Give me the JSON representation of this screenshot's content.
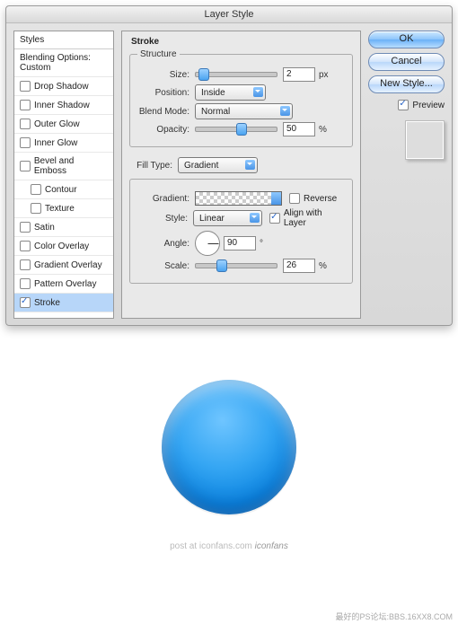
{
  "dialog_title": "Layer Style",
  "styles": {
    "header": "Styles",
    "blending": "Blending Options: Custom",
    "items": [
      {
        "label": "Drop Shadow",
        "on": false
      },
      {
        "label": "Inner Shadow",
        "on": false
      },
      {
        "label": "Outer Glow",
        "on": false
      },
      {
        "label": "Inner Glow",
        "on": false
      },
      {
        "label": "Bevel and Emboss",
        "on": false
      },
      {
        "label": "Contour",
        "on": false,
        "sub": true
      },
      {
        "label": "Texture",
        "on": false,
        "sub": true
      },
      {
        "label": "Satin",
        "on": false
      },
      {
        "label": "Color Overlay",
        "on": false
      },
      {
        "label": "Gradient Overlay",
        "on": false
      },
      {
        "label": "Pattern Overlay",
        "on": false
      },
      {
        "label": "Stroke",
        "on": true,
        "sel": true
      }
    ]
  },
  "panel": {
    "title": "Stroke",
    "structure": {
      "legend": "Structure",
      "size": {
        "label": "Size:",
        "value": "2",
        "unit": "px",
        "knob_pct": 3
      },
      "position": {
        "label": "Position:",
        "selected": "Inside"
      },
      "blend": {
        "label": "Blend Mode:",
        "selected": "Normal"
      },
      "opacity": {
        "label": "Opacity:",
        "value": "50",
        "unit": "%",
        "knob_pct": 50
      }
    },
    "fill": {
      "label": "Fill Type:",
      "selected": "Gradient",
      "gradient_label": "Gradient:",
      "reverse": {
        "label": "Reverse",
        "on": false
      },
      "style": {
        "label": "Style:",
        "selected": "Linear"
      },
      "align": {
        "label": "Align with Layer",
        "on": true
      },
      "angle": {
        "label": "Angle:",
        "value": "90",
        "unit": "°"
      },
      "scale": {
        "label": "Scale:",
        "value": "26",
        "unit": "%",
        "knob_pct": 26
      }
    }
  },
  "buttons": {
    "ok": "OK",
    "cancel": "Cancel",
    "newstyle": "New Style...",
    "preview": "Preview"
  },
  "credit": {
    "prefix": "post at ",
    "site": "iconfans.com ",
    "brand": "iconfans"
  },
  "watermark": "最好的PS论坛:BBS.16XX8.COM"
}
